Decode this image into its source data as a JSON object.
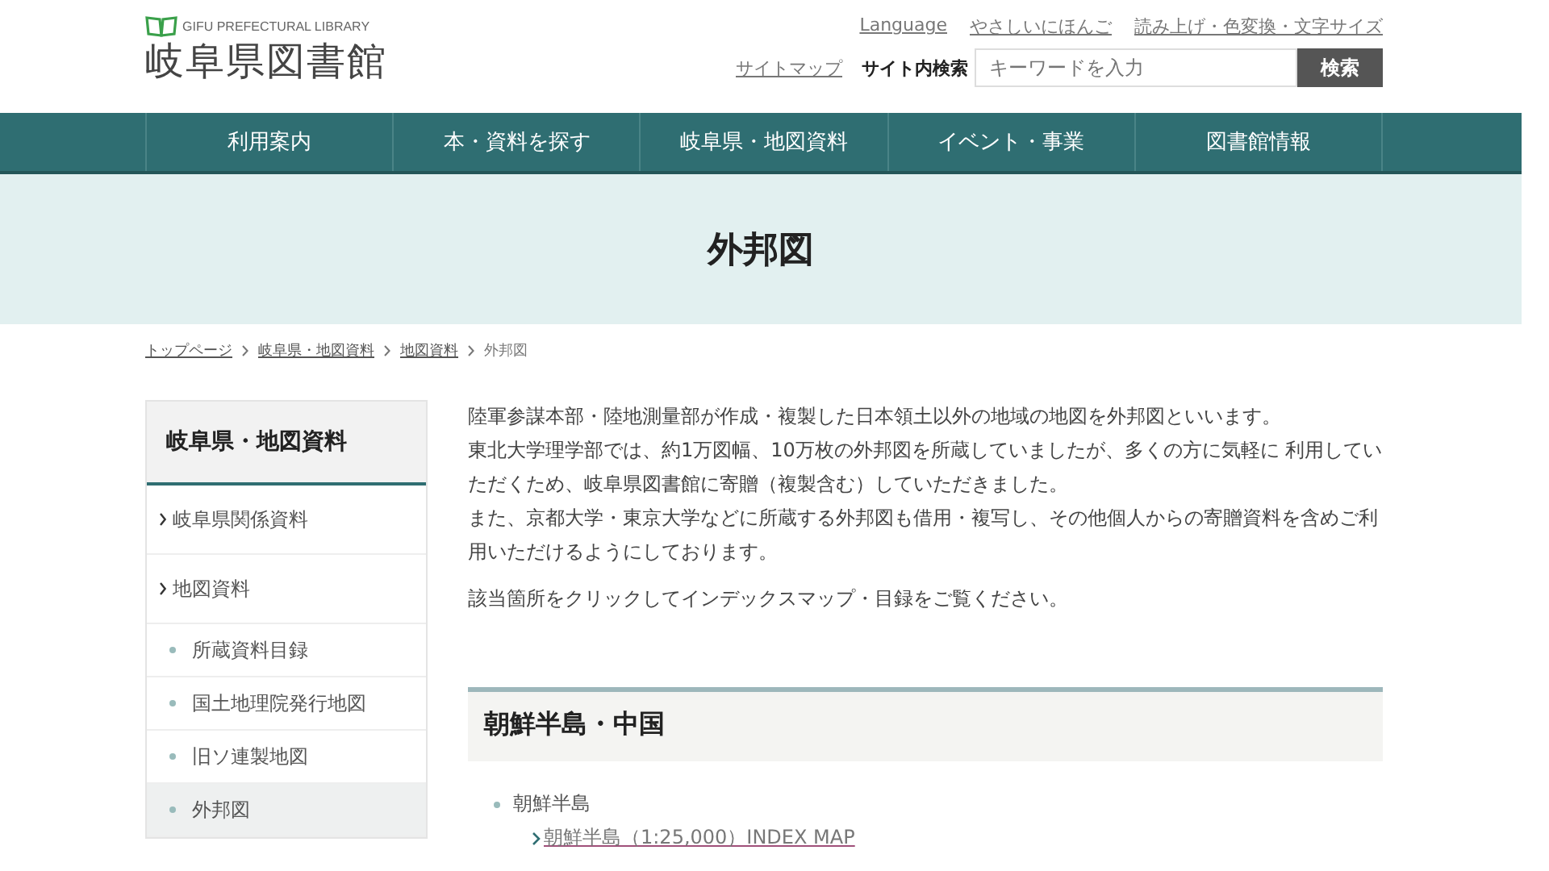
{
  "logo": {
    "subtitle": "GIFU PREFECTURAL LIBRARY",
    "title": "岐阜県図書館"
  },
  "utility_links": [
    "Language",
    "やさしいにほんご",
    "読み上げ・色変換・文字サイズ"
  ],
  "sitemap_link": "サイトマップ",
  "search": {
    "label": "サイト内検索",
    "placeholder": "キーワードを入力",
    "button": "検索"
  },
  "nav": [
    {
      "label": "利用案内"
    },
    {
      "label": "本・資料を探す"
    },
    {
      "label": "岐阜県・地図資料"
    },
    {
      "label": "イベント・事業"
    },
    {
      "label": "図書館情報"
    }
  ],
  "page_title": "外邦図",
  "breadcrumb": [
    {
      "label": "トップページ",
      "link": true
    },
    {
      "label": "岐阜県・地図資料",
      "link": true
    },
    {
      "label": "地図資料",
      "link": true
    },
    {
      "label": "外邦図",
      "link": false
    }
  ],
  "sidebar": {
    "title": "岐阜県・地図資料",
    "items": [
      {
        "label": "岐阜県関係資料",
        "kind": "section",
        "selected": false
      },
      {
        "label": "地図資料",
        "kind": "section",
        "selected": false
      },
      {
        "label": "所蔵資料目録",
        "kind": "sub",
        "selected": false
      },
      {
        "label": "国土地理院発行地図",
        "kind": "sub",
        "selected": false
      },
      {
        "label": "旧ソ連製地図",
        "kind": "sub",
        "selected": false
      },
      {
        "label": "外邦図",
        "kind": "sub",
        "selected": true
      }
    ]
  },
  "intro": {
    "lines": [
      "陸軍参謀本部・陸地測量部が作成・複製した日本領土以外の地域の地図を外邦図といいます。",
      "東北大学理学部では、約1万図幅、10万枚の外邦図を所蔵していましたが、多くの方に気軽に 利用していただくため、岐阜県図書館に寄贈（複製含む）していただきました。",
      "また、京都大学・東京大学などに所蔵する外邦図も借用・複写し、その他個人からの寄贈資料を含めご利用いただけるようにしております。"
    ],
    "note": "該当箇所をクリックしてインデックスマップ・目録をご覧ください。"
  },
  "section": {
    "heading": "朝鮮半島・中国",
    "groups": [
      {
        "label": "朝鮮半島",
        "links": [
          "朝鮮半島（1:25,000）INDEX MAP"
        ]
      }
    ]
  }
}
